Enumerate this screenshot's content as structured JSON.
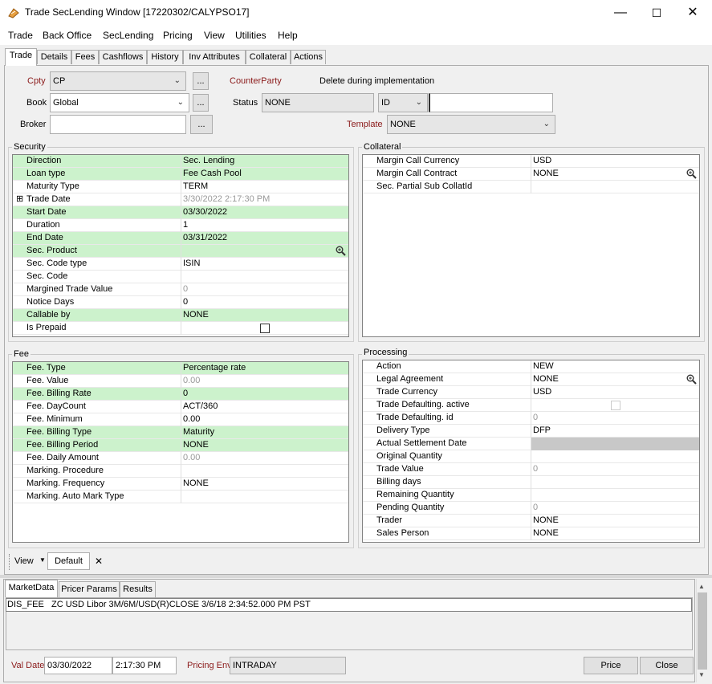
{
  "window": {
    "title": "Trade SecLending Window  [17220302/CALYPSO17]",
    "minimize": "—",
    "maximize": "☐",
    "close": "✕"
  },
  "menu": [
    "Trade",
    "Back Office",
    "SecLending",
    "Pricing",
    "View",
    "Utilities",
    "Help"
  ],
  "tabs": [
    "Trade",
    "Details",
    "Fees",
    "Cashflows",
    "History",
    "Inv Attributes",
    "Collateral",
    "Actions"
  ],
  "header": {
    "cpty_label": "Cpty",
    "cpty_value": "CP",
    "counterparty_label": "CounterParty",
    "counterparty_value": "Delete during implementation",
    "book_label": "Book",
    "book_value": "Global",
    "status_label": "Status",
    "status_value": "NONE",
    "id_combo": "ID",
    "id_value": "",
    "broker_label": "Broker",
    "broker_value": "",
    "template_label": "Template",
    "template_value": "NONE",
    "ellipsis": "..."
  },
  "security": {
    "title": "Security",
    "rows": [
      {
        "k": "Direction",
        "v": "Sec. Lending",
        "g": true
      },
      {
        "k": "Loan type",
        "v": "Fee Cash Pool",
        "g": true
      },
      {
        "k": "Maturity Type",
        "v": "TERM",
        "g": false
      },
      {
        "k": "Trade Date",
        "v": "3/30/2022 2:17:30 PM",
        "g": false,
        "dim": true,
        "expand": true
      },
      {
        "k": "Start Date",
        "v": "03/30/2022",
        "g": true
      },
      {
        "k": "Duration",
        "v": "1",
        "g": false
      },
      {
        "k": "End Date",
        "v": "03/31/2022",
        "g": true
      },
      {
        "k": "Sec. Product",
        "v": "",
        "g": true,
        "mag": true
      },
      {
        "k": "Sec. Code type",
        "v": "ISIN",
        "g": false
      },
      {
        "k": "Sec. Code",
        "v": "",
        "g": false
      },
      {
        "k": "Margined Trade Value",
        "v": "0",
        "g": false,
        "dim": true
      },
      {
        "k": "Notice Days",
        "v": "0",
        "g": false
      },
      {
        "k": "Callable by",
        "v": "NONE",
        "g": true
      },
      {
        "k": "Is Prepaid",
        "v": "",
        "g": false,
        "check": true
      }
    ]
  },
  "collateral": {
    "title": "Collateral",
    "rows": [
      {
        "k": "Margin Call Currency",
        "v": "USD"
      },
      {
        "k": "Margin Call Contract",
        "v": "NONE",
        "mag": true
      },
      {
        "k": "Sec. Partial Sub CollatId",
        "v": ""
      }
    ]
  },
  "fee": {
    "title": "Fee",
    "rows": [
      {
        "k": "Fee. Type",
        "v": "Percentage rate",
        "g": true
      },
      {
        "k": "Fee. Value",
        "v": "0.00",
        "g": false,
        "dim": true
      },
      {
        "k": "Fee. Billing Rate",
        "v": "0",
        "g": true
      },
      {
        "k": "Fee. DayCount",
        "v": "ACT/360",
        "g": false
      },
      {
        "k": "Fee. Minimum",
        "v": "0.00",
        "g": false
      },
      {
        "k": "Fee. Billing Type",
        "v": "Maturity",
        "g": true
      },
      {
        "k": "Fee. Billing Period",
        "v": "NONE",
        "g": true
      },
      {
        "k": "Fee. Daily Amount",
        "v": "0.00",
        "g": false,
        "dim": true
      },
      {
        "k": "Marking. Procedure",
        "v": "",
        "g": false
      },
      {
        "k": "Marking. Frequency",
        "v": "NONE",
        "g": false
      },
      {
        "k": "Marking. Auto Mark Type",
        "v": "",
        "g": false
      }
    ]
  },
  "processing": {
    "title": "Processing",
    "rows": [
      {
        "k": "Action",
        "v": "NEW"
      },
      {
        "k": "Legal Agreement",
        "v": "NONE",
        "mag": true
      },
      {
        "k": "Trade Currency",
        "v": "USD"
      },
      {
        "k": "Trade Defaulting. active",
        "v": "",
        "check": true
      },
      {
        "k": "Trade Defaulting. id",
        "v": "0",
        "dim": true
      },
      {
        "k": "Delivery Type",
        "v": "DFP"
      },
      {
        "k": "Actual Settlement Date",
        "v": "",
        "shade": true
      },
      {
        "k": "Original Quantity",
        "v": ""
      },
      {
        "k": "Trade Value",
        "v": "0",
        "dim": true
      },
      {
        "k": "Billing days",
        "v": ""
      },
      {
        "k": "Remaining Quantity",
        "v": ""
      },
      {
        "k": "Pending Quantity",
        "v": "0",
        "dim": true
      },
      {
        "k": "Trader",
        "v": "NONE"
      },
      {
        "k": "Sales Person",
        "v": "NONE"
      }
    ]
  },
  "viewbar": {
    "view": "View",
    "default": "Default",
    "close": "✕"
  },
  "lower": {
    "tabs": [
      "MarketData",
      "Pricer Params",
      "Results"
    ],
    "market_line": "DIS_FEE   ZC USD Libor 3M/6M/USD(R)CLOSE 3/6/18 2:34:52.000 PM PST",
    "val_date_label": "Val Date",
    "val_date": "03/30/2022",
    "val_time": "2:17:30 PM",
    "pricing_env_label": "Pricing Env",
    "pricing_env": "INTRADAY",
    "price_btn": "Price",
    "close_btn": "Close"
  }
}
